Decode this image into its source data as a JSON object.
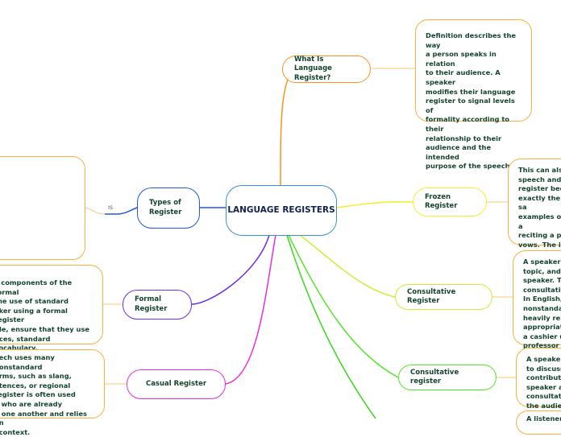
{
  "center": {
    "title": "LANGUAGE REGISTERS"
  },
  "colors": {
    "text": "#14432e",
    "note_border": "#fbb040",
    "center_border": "#3a8fd0"
  },
  "topics": [
    {
      "label": "What Is Language Register?",
      "color": "#f7941d"
    },
    {
      "label": "Frozen Register",
      "color": "#f5ee30"
    },
    {
      "label": "Consultative Register",
      "color": "#c8f032"
    },
    {
      "label": "Consultative register",
      "color": "#57e52a"
    },
    {
      "label": "Types of Register",
      "color": "#2356e8"
    },
    {
      "label": "Formal Register",
      "color": "#6a2ee8"
    },
    {
      "label": "Casual Register",
      "color": "#e82ee0"
    }
  ],
  "notes": {
    "definition": "Definition describes the way\na person speaks in relation\nto their audience. A speaker\nmodifies their language\nregister to signal levels of\nformality according to their\nrelationship to their\naudience and the intended\npurpose of the speech.",
    "frozen": "This can also\nspeech and is\nregister beca\nexactly the sa\nexamples of a\nreciting a ple\nvows. The int\nregister varie\nmany public",
    "consultative1": "A speaker e\ntopic, and t\nspeaker. Th\nconsultativ\nIn English,\nnonstandar\nheavily reli\nappropriate\na cashier us\nprofessor",
    "consultative2": "A speaker\nto discuss\ncontribute\nspeaker ar\nconsultati\nthe audien",
    "bottom": "A listener",
    "formal": "y components of the formal\n the use of standard\naker using a formal register\nple, ensure that they use\nnces, standard vocabulary,\nunciation of words.",
    "casual": "eech uses many nonstandard\norms, such as slang,\nntences, or regional\nregister is often used\ne who are already\nh one another and relies on\nl context.",
    "types": ""
  },
  "link_label": "IS"
}
